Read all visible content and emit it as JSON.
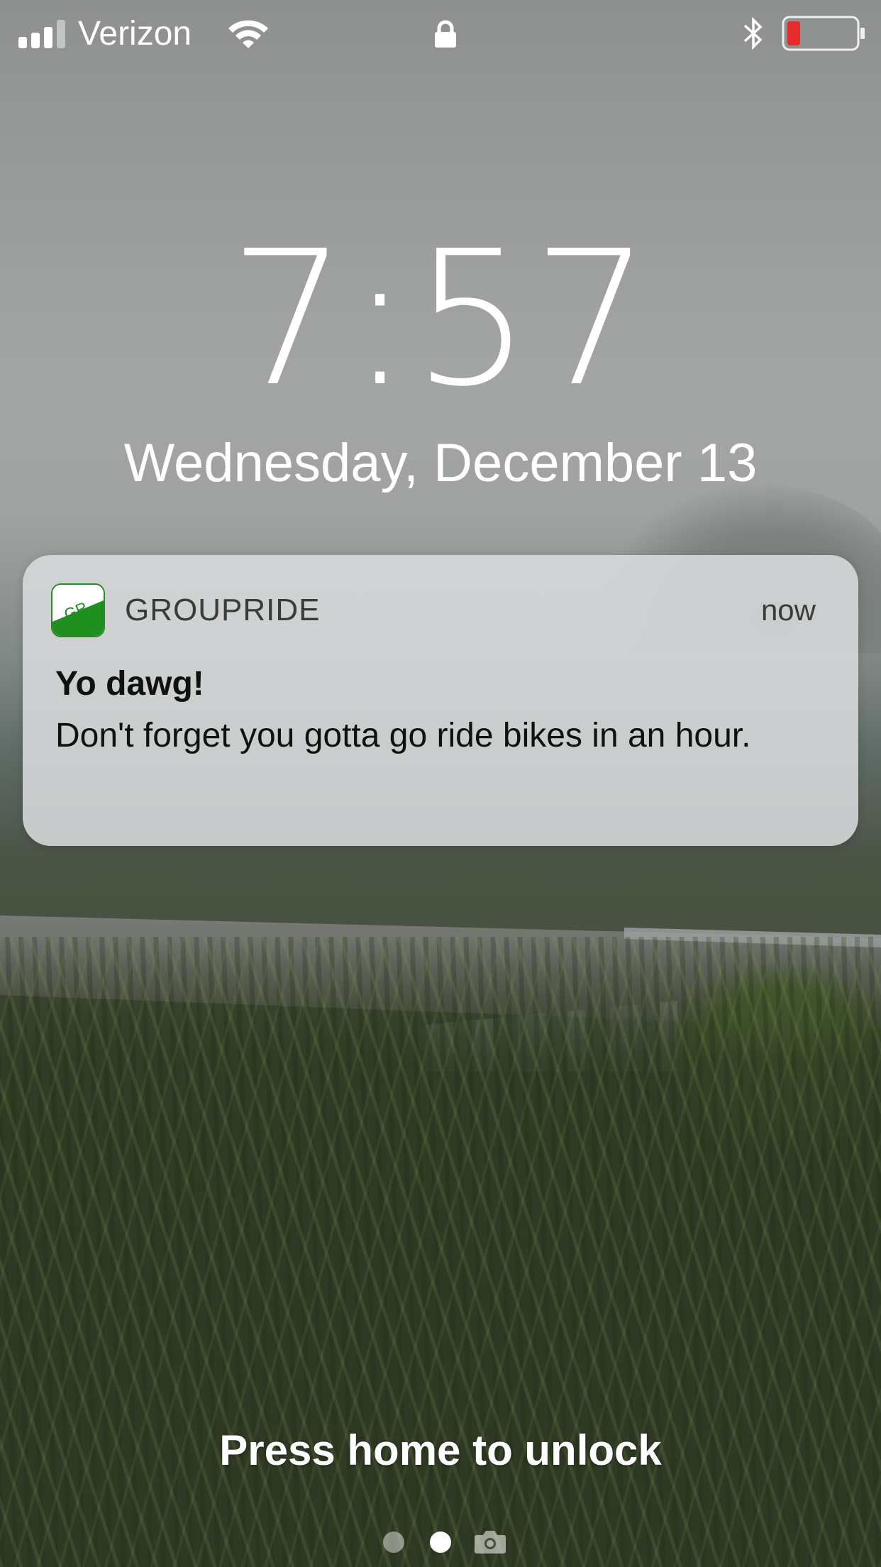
{
  "status_bar": {
    "signal_icon": "signal-bars-icon",
    "carrier": "Verizon",
    "wifi_icon": "wifi-icon",
    "lock_icon": "lock-icon",
    "bluetooth_icon": "bluetooth-icon",
    "battery_icon": "battery-icon",
    "battery_level": 0.1,
    "battery_level_color": "#e52b2b"
  },
  "lock_screen": {
    "time": "7:57",
    "date": "Wednesday, December 13"
  },
  "notification": {
    "app_icon": "groupride-app-icon",
    "app_icon_text": "GR",
    "app_icon_color": "#1f8f1f",
    "app_name": "GROUPRIDE",
    "time": "now",
    "title": "Yo dawg!",
    "body": "Don't forget you gotta go ride bikes in an hour."
  },
  "unlock_hint": "Press home to unlock",
  "page_indicator": {
    "pages": 2,
    "current": 2,
    "camera_icon": "camera-icon"
  }
}
